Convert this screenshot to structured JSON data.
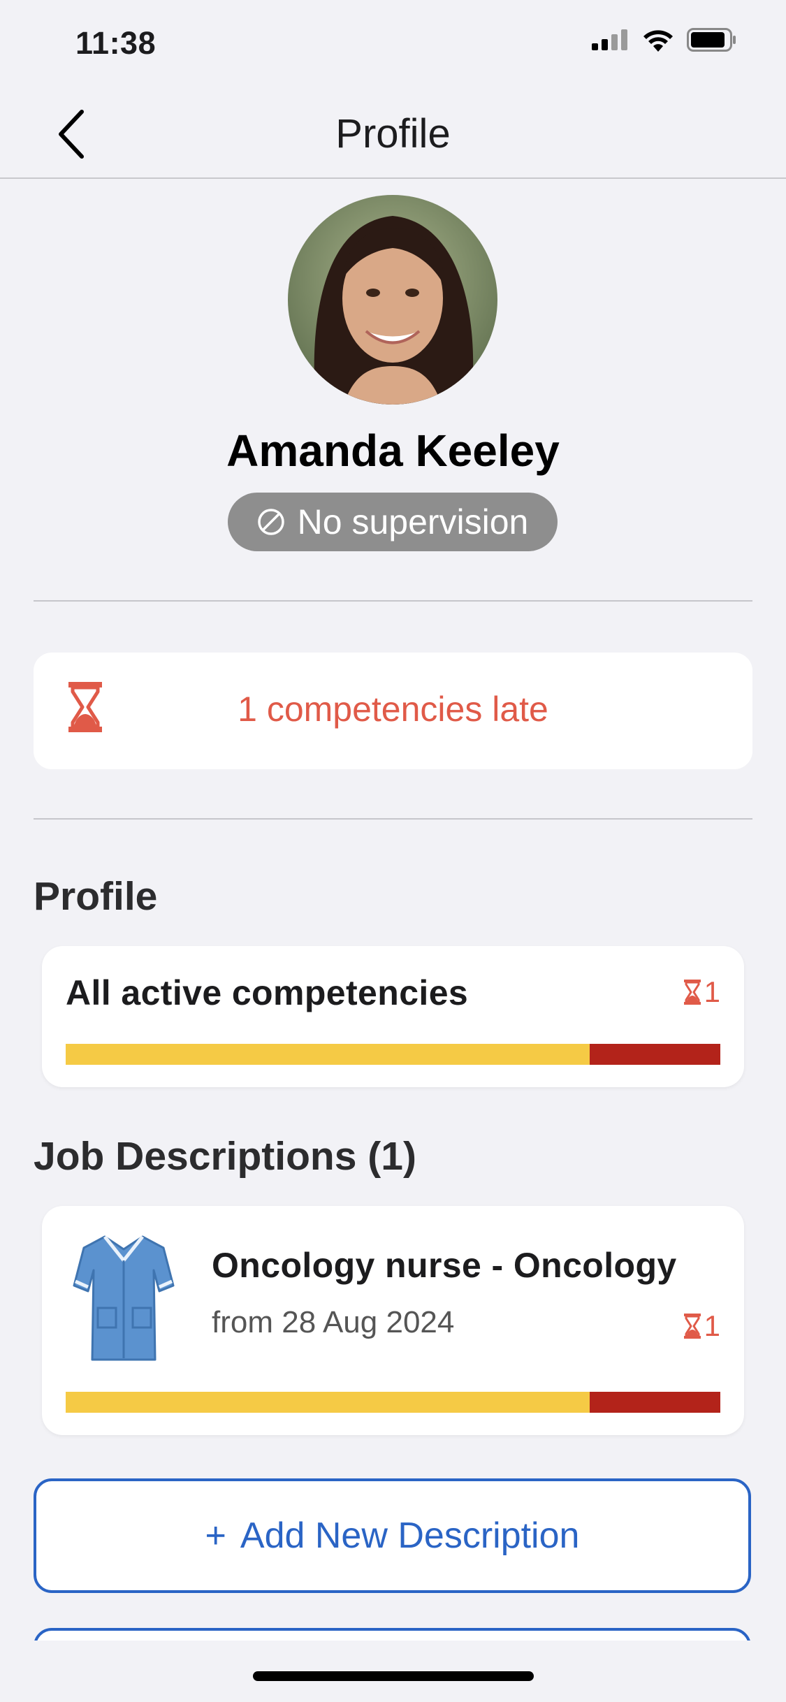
{
  "status_bar": {
    "time": "11:38"
  },
  "nav": {
    "title": "Profile",
    "back_icon": "chevron-left-icon"
  },
  "user": {
    "name": "Amanda Keeley",
    "supervision_label": "No supervision",
    "supervision_icon": "no-entry-icon"
  },
  "late_banner": {
    "text": "1 competencies late",
    "icon": "hourglass-icon"
  },
  "profile_section": {
    "title": "Profile",
    "card": {
      "title": "All active competencies",
      "late_count": "1",
      "progress": {
        "completed_fraction": 0.8,
        "late_fraction": 0.2
      }
    }
  },
  "jobs_section": {
    "title": "Job Descriptions (1)",
    "items": [
      {
        "title": "Oncology nurse - Oncology",
        "subtitle": "from 28 Aug 2024",
        "late_count": "1",
        "icon": "nurse-uniform-icon",
        "progress": {
          "completed_fraction": 0.8,
          "late_fraction": 0.2
        }
      }
    ]
  },
  "actions": {
    "add_label": "Add New Description",
    "add_prefix": "+"
  },
  "colors": {
    "accent": "#2a64c5",
    "late": "#e05a48",
    "bar_completed": "#f5ca45",
    "bar_late": "#b3231a",
    "badge": "#8e8e8e",
    "background": "#f2f2f6"
  }
}
